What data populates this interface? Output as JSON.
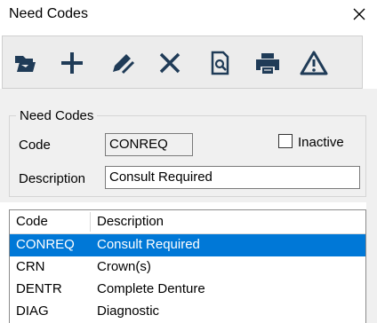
{
  "window": {
    "title": "Need Codes"
  },
  "toolbar": {
    "buttons": [
      {
        "name": "open",
        "icon": "folder-icon"
      },
      {
        "name": "add",
        "icon": "plus-icon"
      },
      {
        "name": "edit",
        "icon": "pencil-icon"
      },
      {
        "name": "delete",
        "icon": "x-icon"
      },
      {
        "name": "preview",
        "icon": "preview-icon"
      },
      {
        "name": "print",
        "icon": "printer-icon"
      },
      {
        "name": "warning",
        "icon": "warning-icon"
      }
    ]
  },
  "form": {
    "group_label": "Need Codes",
    "code_label": "Code",
    "code_value": "CONREQ",
    "inactive_label": "Inactive",
    "inactive_checked": false,
    "description_label": "Description",
    "description_value": "Consult Required"
  },
  "list": {
    "columns": [
      "Code",
      "Description"
    ],
    "rows": [
      {
        "code": "CONREQ",
        "description": "Consult Required",
        "selected": true
      },
      {
        "code": "CRN",
        "description": "Crown(s)",
        "selected": false
      },
      {
        "code": "DENTR",
        "description": "Complete Denture",
        "selected": false
      },
      {
        "code": "DIAG",
        "description": "Diagnostic",
        "selected": false
      }
    ]
  },
  "colors": {
    "selection": "#0078d7",
    "icon": "#1f3b57"
  }
}
